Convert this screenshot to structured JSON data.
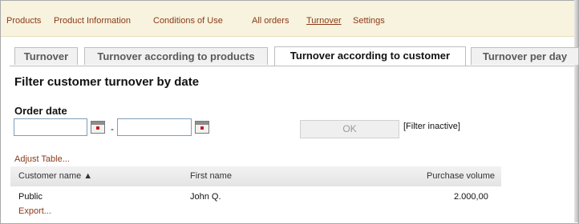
{
  "nav": {
    "items": [
      {
        "label": "Products"
      },
      {
        "label": "Product Information"
      },
      {
        "label": "Conditions of Use"
      },
      {
        "label": "All orders"
      },
      {
        "label": "Turnover",
        "active": true
      },
      {
        "label": "Settings"
      }
    ]
  },
  "tabs": [
    {
      "label": "Turnover"
    },
    {
      "label": "Turnover according to products"
    },
    {
      "label": "Turnover according to customer",
      "active": true
    },
    {
      "label": "Turnover per day"
    }
  ],
  "filter": {
    "title": "Filter customer turnover by date",
    "order_date_label": "Order date",
    "date_from": "",
    "date_to": "",
    "separator": "-",
    "ok_label": "OK",
    "status": "[Filter inactive]"
  },
  "adjust_table_link": "Adjust Table...",
  "table": {
    "columns": [
      {
        "label": "Customer name ▲"
      },
      {
        "label": "First name"
      },
      {
        "label": "Purchase volume"
      }
    ],
    "rows": [
      {
        "customer": "Public",
        "first_name": "John Q.",
        "purchase_volume": "2.000,00"
      }
    ]
  },
  "export_link": "Export...",
  "colors": {
    "link": "#8b3a16",
    "nav_bg": "#f7f3df"
  }
}
